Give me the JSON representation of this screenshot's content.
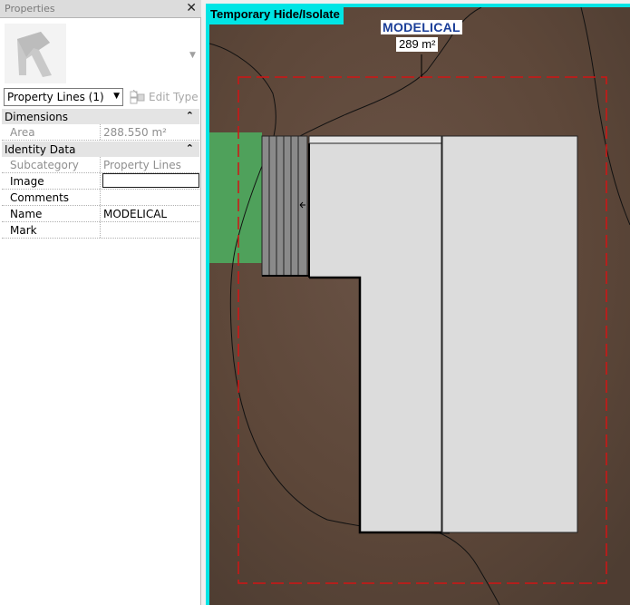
{
  "properties": {
    "title": "Properties",
    "close_glyph": "✕",
    "type_icon": "property-line-type-icon",
    "selector": {
      "value": "Property Lines (1)"
    },
    "edit_type_label": "Edit Type",
    "groups": [
      {
        "label": "Dimensions",
        "rows": [
          {
            "name": "Area",
            "value": "288.550 m²",
            "readonly": true
          }
        ]
      },
      {
        "label": "Identity Data",
        "rows": [
          {
            "name": "Subcategory",
            "value": "Property Lines",
            "readonly": true
          },
          {
            "name": "Image",
            "value": "",
            "readonly": false
          },
          {
            "name": "Comments",
            "value": "",
            "readonly": false
          },
          {
            "name": "Name",
            "value": "MODELICAL",
            "readonly": false
          },
          {
            "name": "Mark",
            "value": "",
            "readonly": false
          }
        ]
      }
    ]
  },
  "view": {
    "mode_banner": "Temporary Hide/Isolate",
    "property_label": {
      "name": "MODELICAL",
      "area": "289 m²"
    },
    "colors": {
      "frame": "#00e5e5",
      "terrain": "#5c4639",
      "property_line": "#d21414",
      "building": "#dcdcdc",
      "lawn": "#4fa15b",
      "label_text": "#1a3e98"
    }
  }
}
